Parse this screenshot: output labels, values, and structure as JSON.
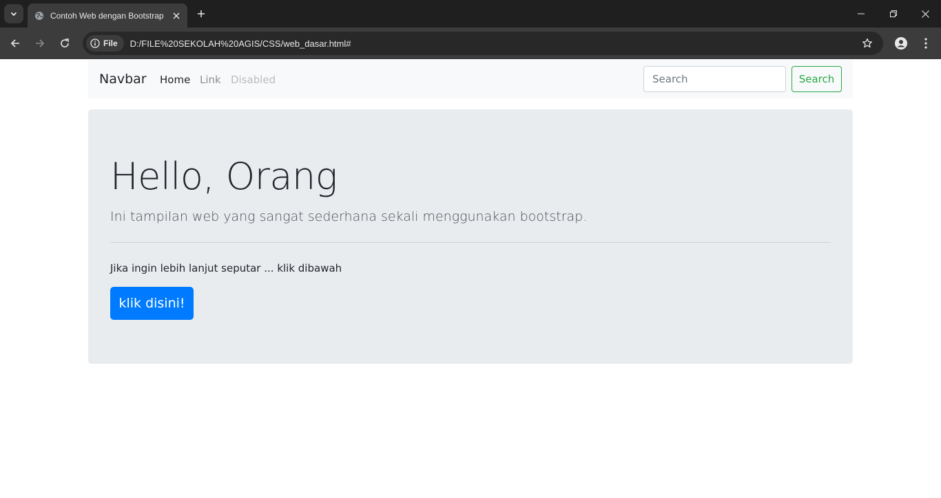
{
  "browser": {
    "tab": {
      "title": "Contoh Web dengan Bootstrap"
    },
    "address_bar": {
      "security_chip": "File",
      "url": "D:/FILE%20SEKOLAH%20AGIS/CSS/web_dasar.html#"
    }
  },
  "navbar": {
    "brand": "Navbar",
    "links": [
      {
        "label": "Home",
        "state": "active"
      },
      {
        "label": "Link",
        "state": "normal"
      },
      {
        "label": "Disabled",
        "state": "disabled"
      }
    ],
    "search": {
      "placeholder": "Search",
      "button_label": "Search"
    }
  },
  "jumbotron": {
    "title": "Hello, Orang",
    "lead": "Ini tampilan web yang sangat sederhana sekali menggunakan bootstrap.",
    "body": "Jika ingin lebih lanjut seputar ... klik dibawah",
    "button_label": "klik disini!"
  },
  "colors": {
    "primary": "#007bff",
    "success": "#28a745",
    "navbar_bg": "#f8f9fa",
    "jumbotron_bg": "#e9ecef",
    "chrome_dark": "#1f1f1f",
    "chrome_toolbar": "#3c3c3c"
  }
}
